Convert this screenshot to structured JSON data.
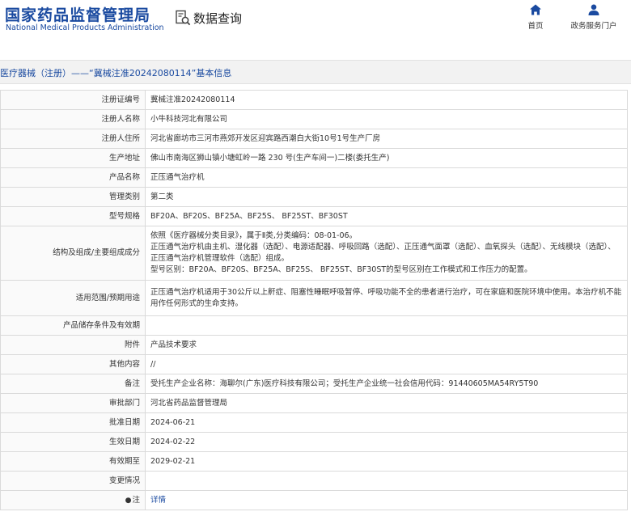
{
  "header": {
    "logo_cn": "国家药品监督管理局",
    "logo_en": "National Medical Products Administration",
    "query_label": "数据查询",
    "nav": [
      {
        "label": "首页",
        "icon": "home-icon"
      },
      {
        "label": "政务服务门户",
        "icon": "user-icon"
      }
    ]
  },
  "breadcrumb": "医疗器械（注册）——“冀械注准20242080114”基本信息",
  "colors": {
    "brand": "#1a4aa0",
    "border": "#dadada",
    "bar": "#f2f2f2"
  },
  "rows": [
    {
      "label": "注册证编号",
      "value": "冀械注准20242080114"
    },
    {
      "label": "注册人名称",
      "value": "小牛科技河北有限公司"
    },
    {
      "label": "注册人住所",
      "value": "河北省廊坊市三河市燕郊开发区迎宾路西潮白大街10号1号生产厂房"
    },
    {
      "label": "生产地址",
      "value": "佛山市南海区狮山镇小塘虹岭一路 230 号(生产车间一)二楼(委托生产)"
    },
    {
      "label": "产品名称",
      "value": "正压通气治疗机"
    },
    {
      "label": "管理类别",
      "value": "第二类"
    },
    {
      "label": "型号规格",
      "value": "BF20A、BF20S、BF25A、BF25S、 BF25ST、BF30ST"
    },
    {
      "label": "结构及组成/主要组成成分",
      "lines": [
        "依照《医疗器械分类目录》，属于Ⅱ类,分类编码：08-01-06。",
        "正压通气治疗机由主机、湿化器（选配）、电源适配器、呼吸回路（选配）、正压通气面罩（选配）、血氧探头（选配）、无线模块（选配）、正压通气治疗机管理软件（选配）组成。",
        "型号区别：BF20A、BF20S、BF25A、BF25S、 BF25ST、BF30ST的型号区别在工作模式和工作压力的配置。"
      ]
    },
    {
      "label": "适用范围/预期用途",
      "value": "正压通气治疗机适用于30公斤以上鼾症、阻塞性睡眠呼吸暂停、呼吸功能不全的患者进行治疗，可在家庭和医院环境中使用。本治疗机不能用作任何形式的生命支持。"
    },
    {
      "label": "产品储存条件及有效期",
      "value": ""
    },
    {
      "label": "附件",
      "value": "产品技术要求"
    },
    {
      "label": "其他内容",
      "value": "//"
    },
    {
      "label": "备注",
      "value": "受托生产企业名称：海聊尔(广东)医疗科技有限公司；受托生产企业统一社会信用代码：91440605MA54RY5T90"
    },
    {
      "label": "审批部门",
      "value": "河北省药品监督管理局"
    },
    {
      "label": "批准日期",
      "value": "2024-06-21"
    },
    {
      "label": "生效日期",
      "value": "2024-02-22"
    },
    {
      "label": "有效期至",
      "value": "2029-02-21"
    },
    {
      "label": "变更情况",
      "value": ""
    },
    {
      "label": "注",
      "value": "详情",
      "pin": "●"
    }
  ]
}
